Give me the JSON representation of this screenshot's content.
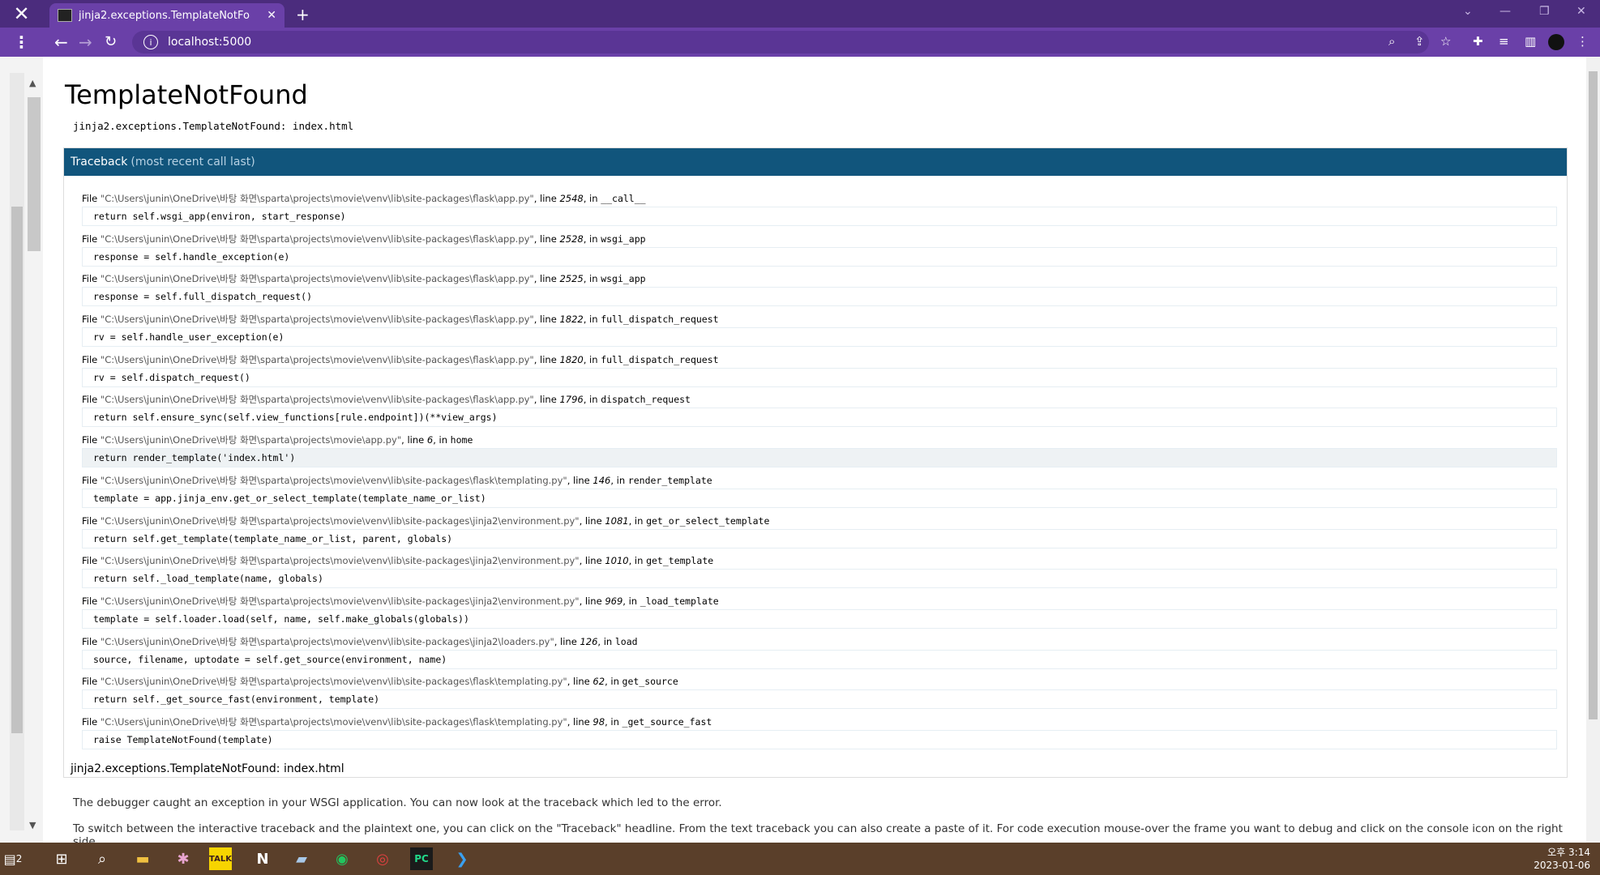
{
  "browser": {
    "tab_title": "jinja2.exceptions.TemplateNotFo",
    "url": "localhost:5000"
  },
  "page": {
    "heading": "TemplateNotFound",
    "error_line": "jinja2.exceptions.TemplateNotFound: index.html",
    "traceback_label": "Traceback",
    "traceback_sub": "(most recent call last)",
    "frames": [
      {
        "path": "\"C:\\Users\\junin\\OneDrive\\바탕 화면\\sparta\\projects\\movie\\venv\\lib\\site-packages\\flask\\app.py\"",
        "line": "2548",
        "func": "__call__",
        "code": "return self.wsgi_app(environ, start_response)"
      },
      {
        "path": "\"C:\\Users\\junin\\OneDrive\\바탕 화면\\sparta\\projects\\movie\\venv\\lib\\site-packages\\flask\\app.py\"",
        "line": "2528",
        "func": "wsgi_app",
        "code": "response = self.handle_exception(e)"
      },
      {
        "path": "\"C:\\Users\\junin\\OneDrive\\바탕 화면\\sparta\\projects\\movie\\venv\\lib\\site-packages\\flask\\app.py\"",
        "line": "2525",
        "func": "wsgi_app",
        "code": "response = self.full_dispatch_request()"
      },
      {
        "path": "\"C:\\Users\\junin\\OneDrive\\바탕 화면\\sparta\\projects\\movie\\venv\\lib\\site-packages\\flask\\app.py\"",
        "line": "1822",
        "func": "full_dispatch_request",
        "code": "rv = self.handle_user_exception(e)"
      },
      {
        "path": "\"C:\\Users\\junin\\OneDrive\\바탕 화면\\sparta\\projects\\movie\\venv\\lib\\site-packages\\flask\\app.py\"",
        "line": "1820",
        "func": "full_dispatch_request",
        "code": "rv = self.dispatch_request()"
      },
      {
        "path": "\"C:\\Users\\junin\\OneDrive\\바탕 화면\\sparta\\projects\\movie\\venv\\lib\\site-packages\\flask\\app.py\"",
        "line": "1796",
        "func": "dispatch_request",
        "code": "return self.ensure_sync(self.view_functions[rule.endpoint])(**view_args)"
      },
      {
        "path": "\"C:\\Users\\junin\\OneDrive\\바탕 화면\\sparta\\projects\\movie\\app.py\"",
        "line": "6",
        "func": "home",
        "code": "return render_template('index.html')"
      },
      {
        "path": "\"C:\\Users\\junin\\OneDrive\\바탕 화면\\sparta\\projects\\movie\\venv\\lib\\site-packages\\flask\\templating.py\"",
        "line": "146",
        "func": "render_template",
        "code": "template = app.jinja_env.get_or_select_template(template_name_or_list)"
      },
      {
        "path": "\"C:\\Users\\junin\\OneDrive\\바탕 화면\\sparta\\projects\\movie\\venv\\lib\\site-packages\\jinja2\\environment.py\"",
        "line": "1081",
        "func": "get_or_select_template",
        "code": "return self.get_template(template_name_or_list, parent, globals)"
      },
      {
        "path": "\"C:\\Users\\junin\\OneDrive\\바탕 화면\\sparta\\projects\\movie\\venv\\lib\\site-packages\\jinja2\\environment.py\"",
        "line": "1010",
        "func": "get_template",
        "code": "return self._load_template(name, globals)"
      },
      {
        "path": "\"C:\\Users\\junin\\OneDrive\\바탕 화면\\sparta\\projects\\movie\\venv\\lib\\site-packages\\jinja2\\environment.py\"",
        "line": "969",
        "func": "_load_template",
        "code": "template = self.loader.load(self, name, self.make_globals(globals))"
      },
      {
        "path": "\"C:\\Users\\junin\\OneDrive\\바탕 화면\\sparta\\projects\\movie\\venv\\lib\\site-packages\\jinja2\\loaders.py\"",
        "line": "126",
        "func": "load",
        "code": "source, filename, uptodate = self.get_source(environment, name)"
      },
      {
        "path": "\"C:\\Users\\junin\\OneDrive\\바탕 화면\\sparta\\projects\\movie\\venv\\lib\\site-packages\\flask\\templating.py\"",
        "line": "62",
        "func": "get_source",
        "code": "return self._get_source_fast(environment, template)"
      },
      {
        "path": "\"C:\\Users\\junin\\OneDrive\\바탕 화면\\sparta\\projects\\movie\\venv\\lib\\site-packages\\flask\\templating.py\"",
        "line": "98",
        "func": "_get_source_fast",
        "code": "raise TemplateNotFound(template)"
      }
    ],
    "final_error": "jinja2.exceptions.TemplateNotFound: index.html",
    "explanation_1": "The debugger caught an exception in your WSGI application. You can now look at the traceback which led to the error.",
    "explanation_2": "To switch between the interactive traceback and the plaintext one, you can click on the \"Traceback\" headline. From the text traceback you can also create a paste of it. For code execution mouse-over the frame you want to debug and click on the console icon on the right side."
  },
  "taskbar": {
    "notification_count": "2",
    "time": "오후 3:14",
    "date": "2023-01-06"
  },
  "colors": {
    "traceback_header": "#11557c",
    "browser_frame": "#6a40a8"
  }
}
